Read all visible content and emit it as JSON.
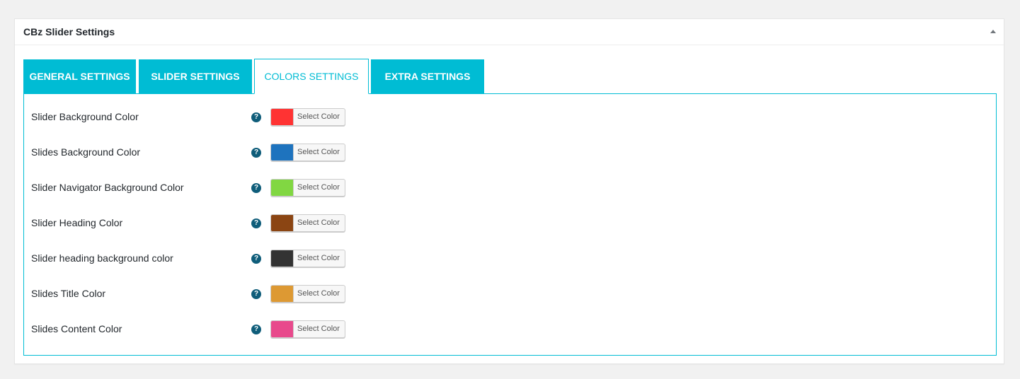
{
  "postbox": {
    "title": "CBz Slider Settings"
  },
  "tabs": [
    {
      "label": "GENERAL SETTINGS",
      "active": false
    },
    {
      "label": "SLIDER SETTINGS",
      "active": false
    },
    {
      "label": "COLORS SETTINGS",
      "active": true
    },
    {
      "label": "EXTRA SETTINGS",
      "active": false
    }
  ],
  "colors": {
    "accent": "#00bcd4",
    "help_icon": "#0f5d7a"
  },
  "settings": [
    {
      "label": "Slider Background Color",
      "color": "#ff3333",
      "button_label": "Select Color"
    },
    {
      "label": "Slides Background Color",
      "color": "#1e73be",
      "button_label": "Select Color"
    },
    {
      "label": "Slider Navigator Background Color",
      "color": "#81d742",
      "button_label": "Select Color"
    },
    {
      "label": "Slider Heading Color",
      "color": "#8b4513",
      "button_label": "Select Color"
    },
    {
      "label": "Slider heading background color",
      "color": "#333333",
      "button_label": "Select Color"
    },
    {
      "label": "Slides Title Color",
      "color": "#dd9933",
      "button_label": "Select Color"
    },
    {
      "label": "Slides Content Color",
      "color": "#e84a8c",
      "button_label": "Select Color"
    }
  ],
  "help_icon_glyph": "?"
}
